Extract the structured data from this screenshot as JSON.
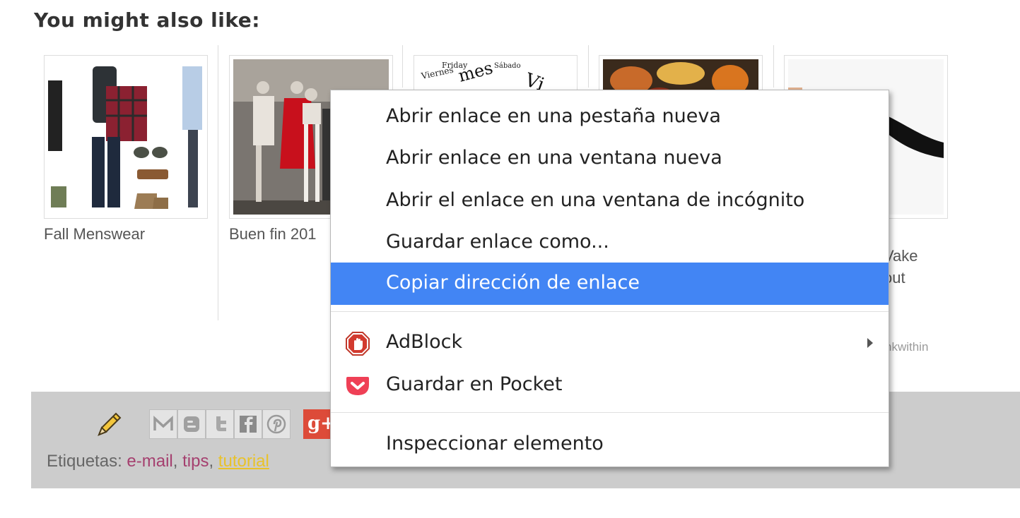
{
  "heading": "You might also like:",
  "related": [
    {
      "caption": "Fall Menswear"
    },
    {
      "caption": "Buen fin 201"
    },
    {
      "caption": ""
    },
    {
      "caption": ""
    },
    {
      "caption_line1": "Vake",
      "caption_line2": "out"
    }
  ],
  "thumb3_words": [
    "Friday",
    "Viernes",
    "Sábado",
    "mes",
    "Vi"
  ],
  "credit": "nkwithin",
  "context_menu": {
    "items": [
      {
        "label": "Abrir enlace en una pestaña nueva"
      },
      {
        "label": "Abrir enlace en una ventana nueva"
      },
      {
        "label": "Abrir el enlace en una ventana de incógnito"
      },
      {
        "label": "Guardar enlace como..."
      },
      {
        "label": "Copiar dirección de enlace"
      }
    ],
    "extensions": [
      {
        "label": "AdBlock",
        "icon": "adblock-icon"
      },
      {
        "label": "Guardar en Pocket",
        "icon": "pocket-icon"
      }
    ],
    "inspect": "Inspeccionar elemento",
    "highlight_color": "#4285f4"
  },
  "share": {
    "buttons": [
      "email-icon",
      "blogger-icon",
      "twitter-icon",
      "facebook-icon",
      "pinterest-icon"
    ],
    "gplus_label": "g+"
  },
  "labels": {
    "prefix": "Etiquetas:",
    "tags": [
      "e-mail",
      "tips",
      "tutorial"
    ]
  }
}
